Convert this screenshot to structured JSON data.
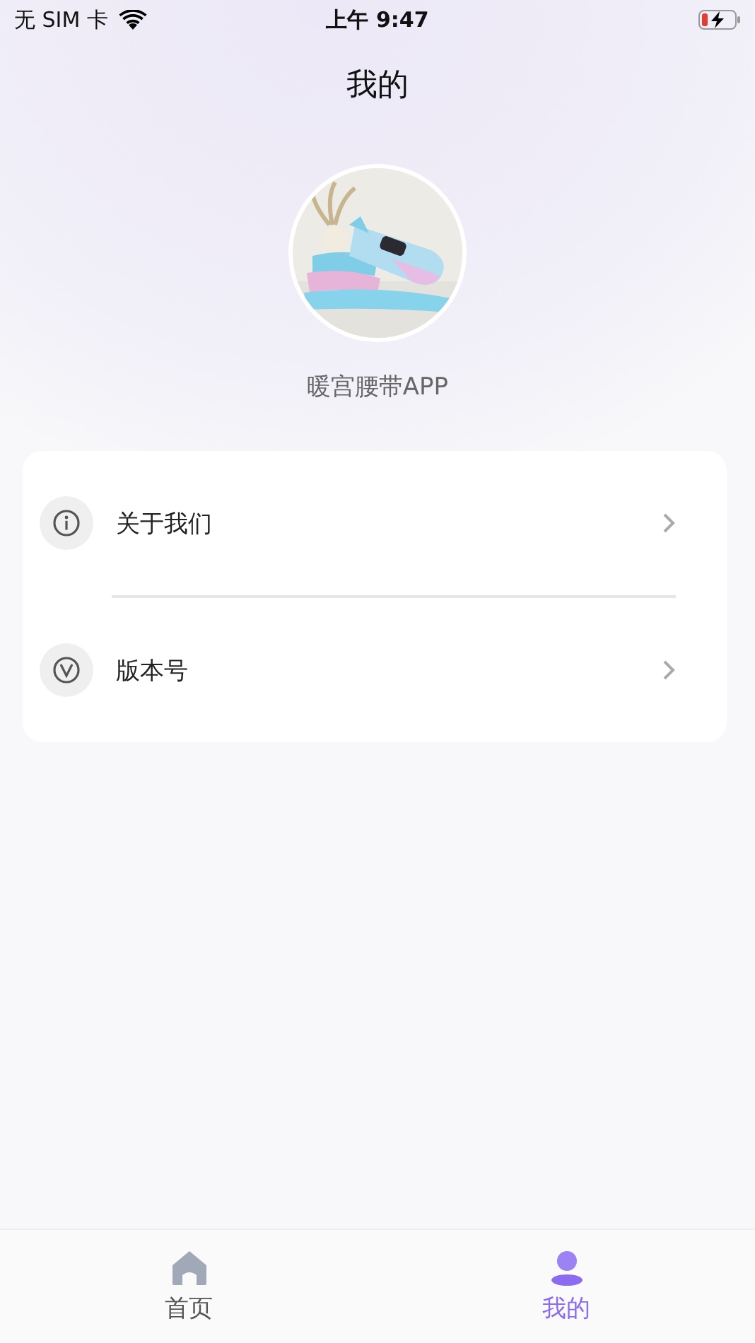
{
  "status_bar": {
    "carrier": "无 SIM 卡",
    "time": "上午 9:47"
  },
  "title": "我的",
  "profile": {
    "name": "暖宫腰带APP"
  },
  "menu": [
    {
      "kind": "info",
      "label": "关于我们"
    },
    {
      "kind": "version",
      "label": "版本号"
    }
  ],
  "tab_bar": [
    {
      "kind": "home",
      "label": "首页",
      "selected": false
    },
    {
      "kind": "profile",
      "label": "我的",
      "selected": true
    }
  ]
}
